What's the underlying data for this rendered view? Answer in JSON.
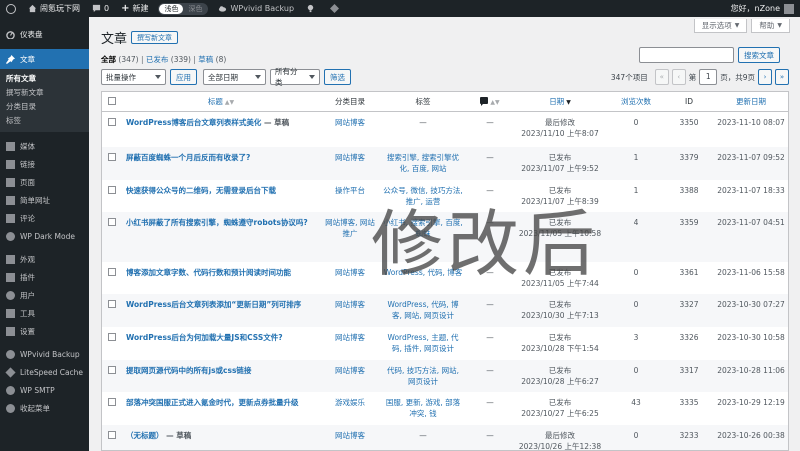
{
  "adminbar": {
    "site_name": "闹氪玩下网",
    "comments_count": "0",
    "new_label": "新建",
    "mode_light": "浅色",
    "mode_dark": "深色",
    "backup_label": "WPvivid Backup",
    "greeting": "您好，nZone"
  },
  "sidebar": {
    "dashboard": "仪表盘",
    "posts": "文章",
    "submenu": [
      "所有文章",
      "撰写新文章",
      "分类目录",
      "标签"
    ],
    "items": [
      "媒体",
      "链接",
      "页面",
      "简单网址",
      "评论",
      "WP Dark Mode",
      "外观",
      "插件",
      "用户",
      "工具",
      "设置",
      "WPvivid Backup",
      "LiteSpeed Cache",
      "WP SMTP",
      "收起菜单"
    ]
  },
  "header": {
    "screen_options": "显示选项",
    "help": "帮助",
    "title": "文章",
    "add_new": "撰写新文章"
  },
  "views": {
    "all_label": "全部",
    "all_count": "(347)",
    "published_label": "已发布",
    "published_count": "(339)",
    "draft_label": "草稿",
    "draft_count": "(8)",
    "sep": "|"
  },
  "search": {
    "button": "搜索文章",
    "value": ""
  },
  "tablenav": {
    "bulk_action": "批量操作",
    "apply": "应用",
    "all_dates": "全部日期",
    "all_categories": "所有分类",
    "filter": "筛选",
    "items_count": "347个项目",
    "first": "«",
    "prev": "‹",
    "page_prefix": "第",
    "current_page": "1",
    "page_suffix": "页，共9页",
    "next": "›",
    "last": "»"
  },
  "columns": {
    "title": "标题",
    "category": "分类目录",
    "tags": "标签",
    "date": "日期",
    "views": "浏览次数",
    "id": "ID",
    "modified": "更新日期"
  },
  "rows": [
    {
      "title": "WordPress博客后台文章列表样式美化",
      "state": " — 草稿",
      "category": "网站博客",
      "tags": "—",
      "comments": "—",
      "date_status": "最后修改",
      "date": "2023/11/10 上午8:07",
      "views": "0",
      "id": "3350",
      "modified": "2023-11-10 08:07"
    },
    {
      "title": "屏蔽百度蜘蛛一个月后反而有收录了?",
      "state": "",
      "category": "网站博客",
      "tags": "搜索引擎, 搜索引擎优化, 百度, 网站",
      "comments": "—",
      "date_status": "已发布",
      "date": "2023/11/07 上午9:52",
      "views": "1",
      "id": "3379",
      "modified": "2023-11-07 09:52"
    },
    {
      "title": "快速获得公众号的二维码，无需登录后台下载",
      "state": "",
      "category": "操作平台",
      "tags": "公众号, 微信, 技巧方法, 推广, 运营",
      "comments": "—",
      "date_status": "已发布",
      "date": "2023/11/07 上午8:39",
      "views": "1",
      "id": "3388",
      "modified": "2023-11-07 18:33"
    },
    {
      "title": "小红书屏蔽了所有搜索引擎，蜘蛛遵守robots协议吗?",
      "state": "",
      "category": "网站博客, 网站推广",
      "tags": "小红书, 搜索引擎, 百度, 蜘蛛",
      "comments": "—",
      "date_status": "已发布",
      "date": "2023/11/05 上午10:58",
      "views": "4",
      "id": "3359",
      "modified": "2023-11-07 04:51"
    },
    {
      "title": "博客添加文章字数、代码行数和预计阅读时间功能",
      "state": "",
      "category": "网站博客",
      "tags": "WordPress, 代码, 博客",
      "comments": "—",
      "date_status": "已发布",
      "date": "2023/11/05 上午7:44",
      "views": "0",
      "id": "3361",
      "modified": "2023-11-06 15:58"
    },
    {
      "title": "WordPress后台文章列表添加“更新日期”列可排序",
      "state": "",
      "category": "网站博客",
      "tags": "WordPress, 代码, 博客, 网站, 网页设计",
      "comments": "—",
      "date_status": "已发布",
      "date": "2023/10/30 上午7:13",
      "views": "0",
      "id": "3327",
      "modified": "2023-10-30 07:27"
    },
    {
      "title": "WordPress后台为何加载大量JS和CSS文件?",
      "state": "",
      "category": "网站博客",
      "tags": "WordPress, 主题, 代码, 插件, 网页设计",
      "comments": "—",
      "date_status": "已发布",
      "date": "2023/10/28 下午1:54",
      "views": "3",
      "id": "3326",
      "modified": "2023-10-30 10:58"
    },
    {
      "title": "提取网页源代码中的所有js或css链接",
      "state": "",
      "category": "网站博客",
      "tags": "代码, 技巧方法, 网站, 网页设计",
      "comments": "—",
      "date_status": "已发布",
      "date": "2023/10/28 上午6:27",
      "views": "0",
      "id": "3317",
      "modified": "2023-10-28 11:06"
    },
    {
      "title": "部落冲突国服正式进入氪金时代，更新点券批量升级",
      "state": "",
      "category": "游戏娱乐",
      "tags": "国服, 更新, 游戏, 部落冲突, 钱",
      "comments": "—",
      "date_status": "已发布",
      "date": "2023/10/27 上午6:25",
      "views": "43",
      "id": "3335",
      "modified": "2023-10-29 12:19"
    },
    {
      "title": "（无标题）",
      "state": " — 草稿",
      "category": "网站博客",
      "tags": "—",
      "comments": "—",
      "date_status": "最后修改",
      "date": "2023/10/26 上午12:38",
      "views": "0",
      "id": "3233",
      "modified": "2023-10-26 00:38"
    }
  ],
  "watermark": "修改后",
  "colors": {
    "adminbar": "#1d2327",
    "accent": "#2271b1",
    "background": "#f0f0f1"
  }
}
